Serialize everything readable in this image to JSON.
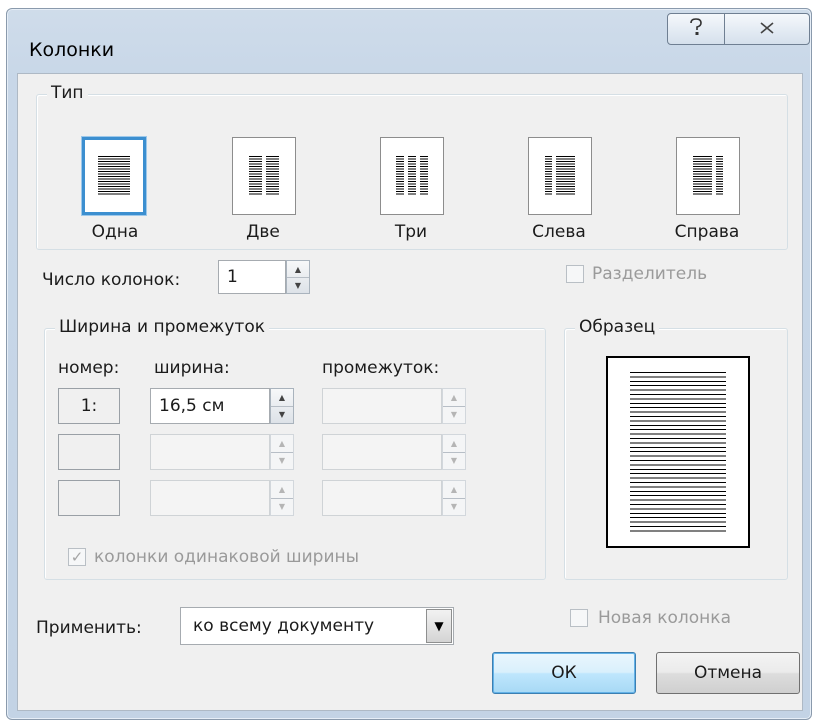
{
  "dialog": {
    "title": "Колонки",
    "help_icon": "question-mark-icon",
    "close_icon": "close-x-icon"
  },
  "type_group": {
    "label": "Тип",
    "presets": [
      {
        "label": "Одна",
        "columns": 1,
        "selected": true
      },
      {
        "label": "Две",
        "columns": 2,
        "selected": false
      },
      {
        "label": "Три",
        "columns": 3,
        "selected": false
      },
      {
        "label": "Слева",
        "columns": "left",
        "selected": false
      },
      {
        "label": "Справа",
        "columns": "right",
        "selected": false
      }
    ]
  },
  "column_count": {
    "label": "Число колонок:",
    "value": "1"
  },
  "separator": {
    "label": "Разделитель",
    "checked": false,
    "enabled": false
  },
  "width_spacing": {
    "label": "Ширина и промежуток",
    "col_number_header": "номер:",
    "col_width_header": "ширина:",
    "col_spacing_header": "промежуток:",
    "rows": [
      {
        "number": "1:",
        "width": "16,5 см",
        "spacing": ""
      },
      {
        "number": "",
        "width": "",
        "spacing": ""
      },
      {
        "number": "",
        "width": "",
        "spacing": ""
      }
    ],
    "equal_width": {
      "label": "колонки одинаковой ширины",
      "checked": true,
      "enabled": false
    }
  },
  "preview": {
    "label": "Образец"
  },
  "apply": {
    "label": "Применить:",
    "value": "ко всему документу"
  },
  "new_column": {
    "label": "Новая колонка",
    "checked": false,
    "enabled": false
  },
  "buttons": {
    "ok": "ОК",
    "cancel": "Отмена"
  },
  "colors": {
    "selection_border": "#3c8fd0",
    "frame": "#c8d7e8",
    "face": "#f0f0f0"
  }
}
